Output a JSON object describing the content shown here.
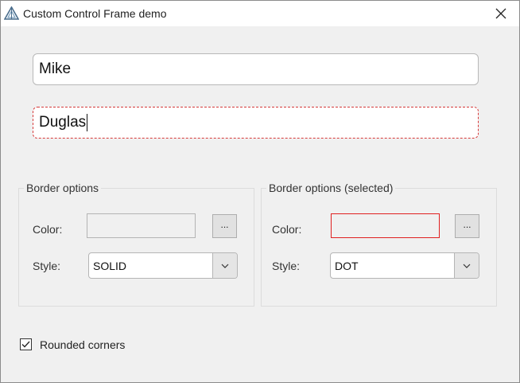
{
  "window": {
    "title": "Custom Control Frame demo",
    "app_icon": "delta-triangle-icon",
    "close_icon": "close-x-icon"
  },
  "fields": {
    "first_name": "Mike",
    "last_name": "Duglas",
    "last_name_border_color": "#d63a3a"
  },
  "border_options": {
    "title": "Border options",
    "color_label": "Color:",
    "color_value": "#f0f0f0",
    "picker_label": "...",
    "style_label": "Style:",
    "style_value": "SOLID"
  },
  "border_options_selected": {
    "title": "Border options (selected)",
    "color_label": "Color:",
    "color_value": "#e02020",
    "picker_label": "...",
    "style_label": "Style:",
    "style_value": "DOT"
  },
  "rounded_corners": {
    "label": "Rounded corners",
    "checked": true
  }
}
